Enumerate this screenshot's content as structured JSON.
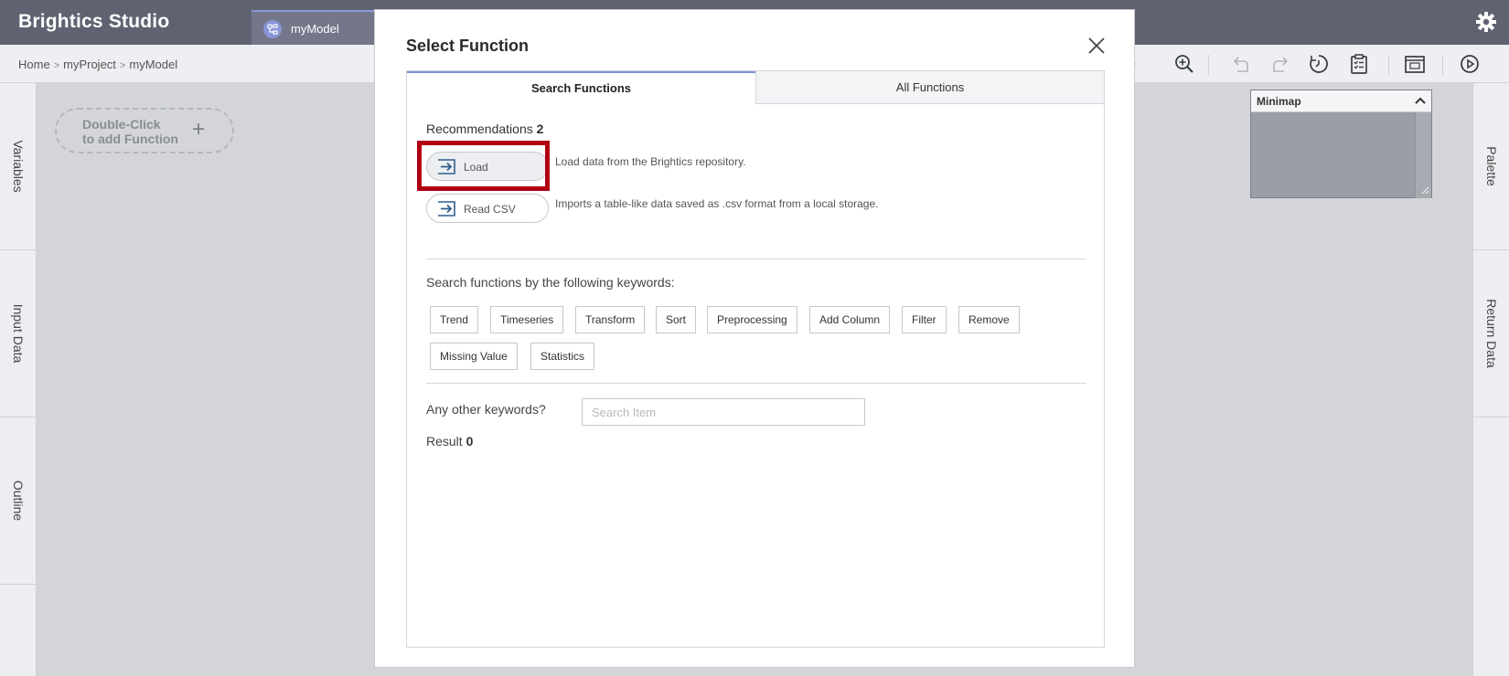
{
  "app": {
    "title": "Brightics Studio"
  },
  "tabs": [
    {
      "label": "myModel",
      "icon": "model-icon"
    }
  ],
  "breadcrumb": [
    "Home",
    "myProject",
    "myModel"
  ],
  "left_panel": [
    "Variables",
    "Input Data",
    "Outline"
  ],
  "right_panel": [
    "Palette",
    "Return Data"
  ],
  "canvas": {
    "add_function_line1": "Double-Click",
    "add_function_line2": "to add Function",
    "add_icon": "+"
  },
  "minimap": {
    "title": "Minimap"
  },
  "modal": {
    "title": "Select Function",
    "tabs": [
      "Search Functions",
      "All Functions"
    ],
    "recommendations_label": "Recommendations",
    "recommendations_count": "2",
    "recommendations": [
      {
        "name": "Load",
        "description": "Load data from the Brightics repository."
      },
      {
        "name": "Read CSV",
        "description": "Imports a table-like data saved as .csv format from a local storage."
      }
    ],
    "keywords_title": "Search functions by the following keywords:",
    "keywords": [
      "Trend",
      "Timeseries",
      "Transform",
      "Sort",
      "Preprocessing",
      "Add Column",
      "Filter",
      "Remove",
      "Missing Value",
      "Statistics"
    ],
    "other_keywords_label": "Any other keywords?",
    "search_placeholder": "Search Item",
    "result_label": "Result",
    "result_count": "0"
  },
  "colors": {
    "topbar": "#5f6270",
    "accent": "#7b92d6",
    "highlight": "#b00012",
    "icon_blue": "#2f5f8f"
  }
}
